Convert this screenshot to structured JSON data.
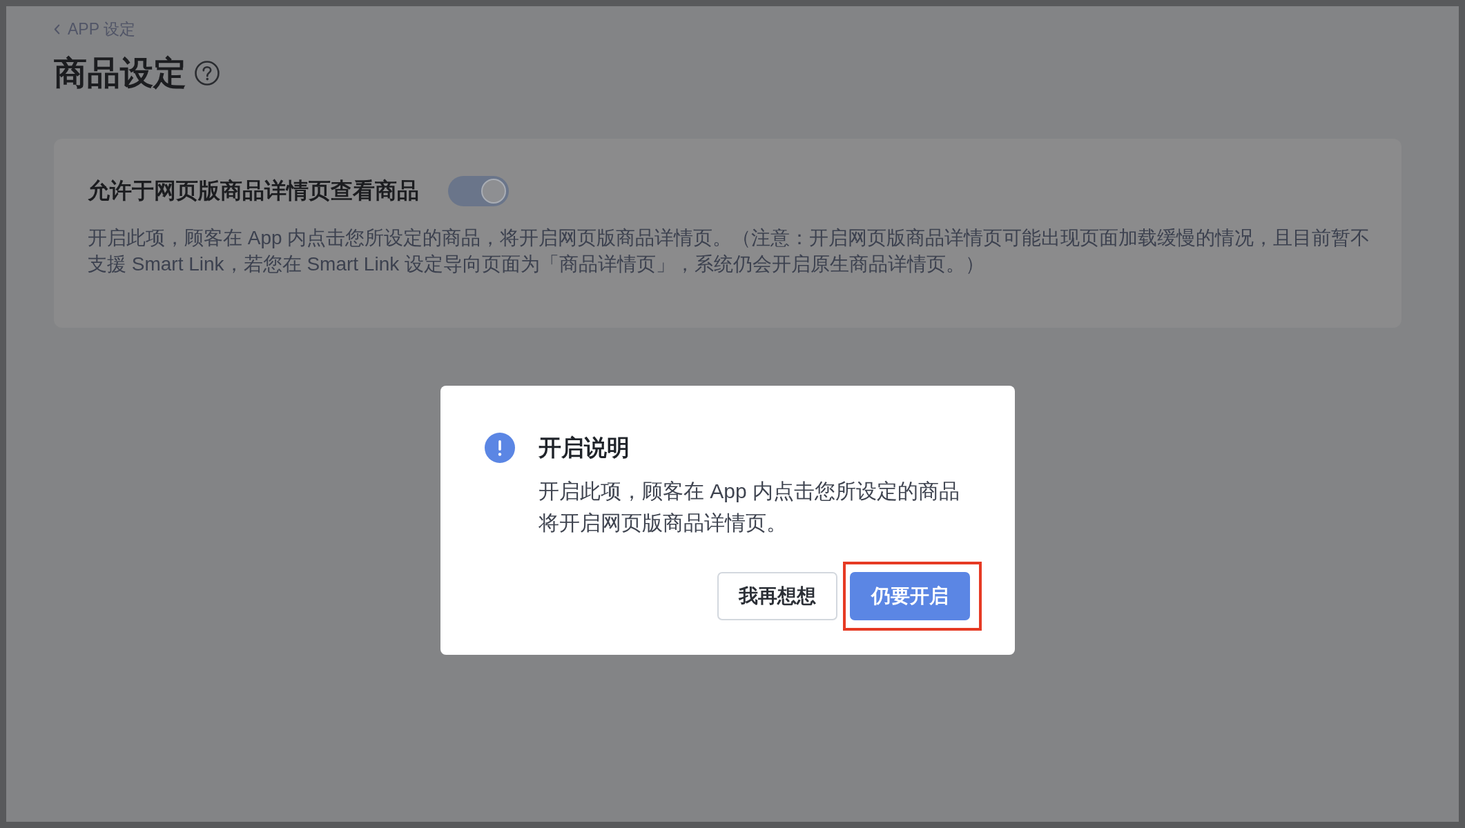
{
  "breadcrumb": {
    "back_label": "APP 设定"
  },
  "page": {
    "title": "商品设定"
  },
  "setting": {
    "label": "允许于网页版商品详情页查看商品",
    "on": true,
    "description": "开启此项，顾客在 App 内点击您所设定的商品，将开启网页版商品详情页。（注意：开启网页版商品详情页可能出现页面加载缓慢的情况，且目前暂不支援 Smart Link，若您在 Smart Link 设定导向页面为「商品详情页」，系统仍会开启原生商品详情页。）"
  },
  "dialog": {
    "title": "开启说明",
    "message": "开启此项，顾客在 App 内点击您所设定的商品将开启网页版商品详情页。",
    "buttons": [
      {
        "label": "我再想想",
        "kind": "secondary",
        "highlighted": false
      },
      {
        "label": "仍要开启",
        "kind": "primary",
        "highlighted": true
      }
    ]
  }
}
